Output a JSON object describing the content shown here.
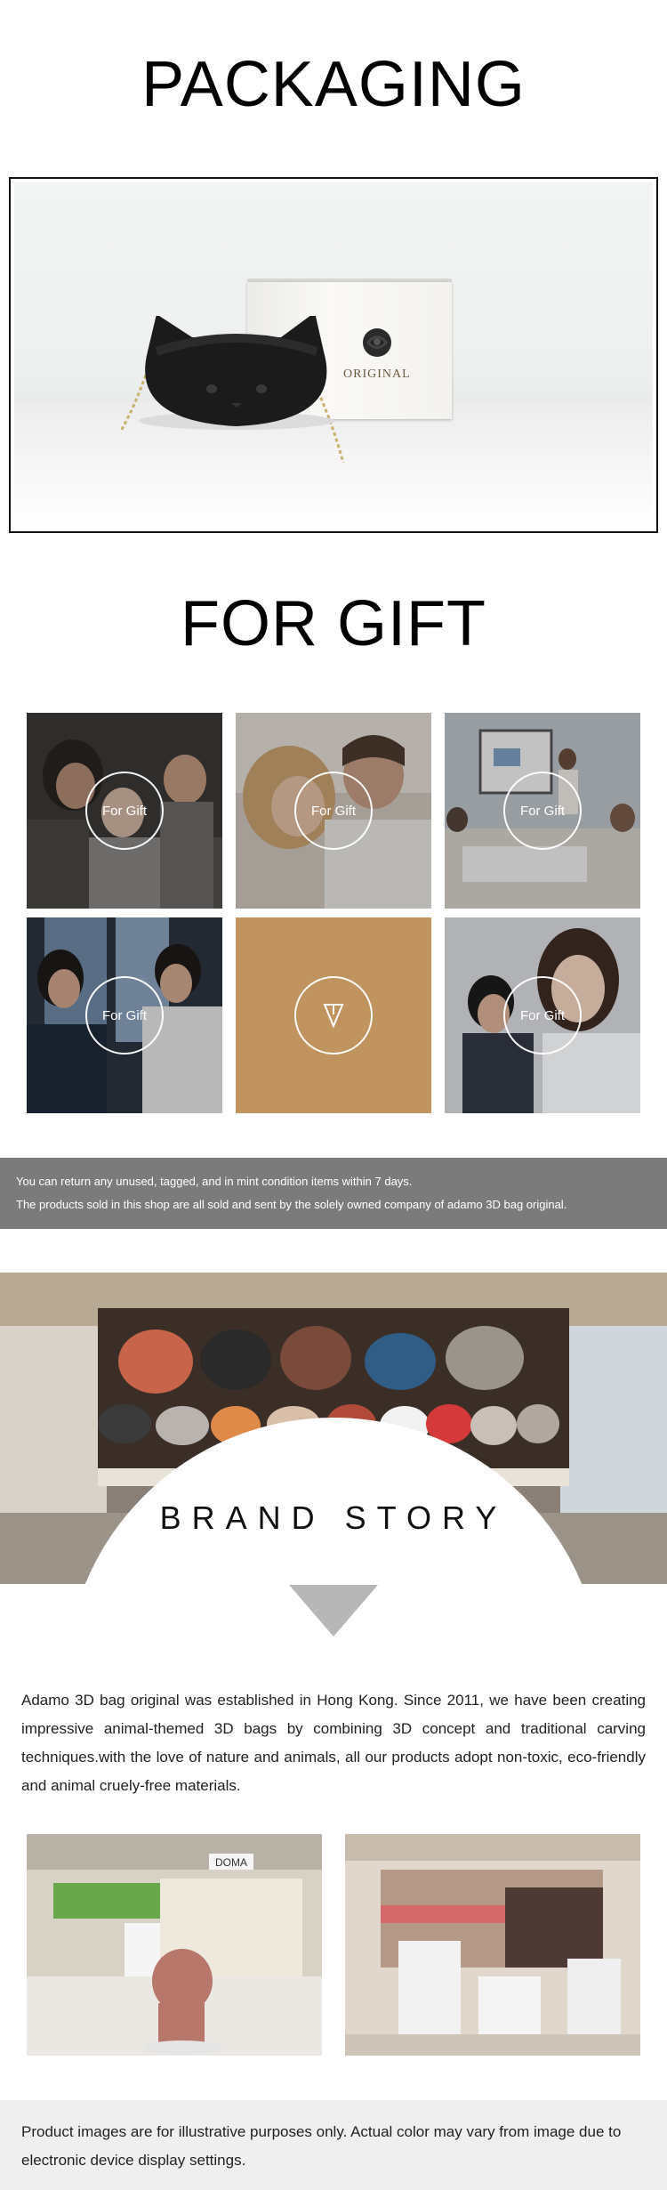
{
  "packaging": {
    "title": "PACKAGING",
    "box_logo_text": "ORIGINAL"
  },
  "gift": {
    "title": "FOR GIFT",
    "tiles": [
      {
        "label": "For Gift",
        "icon": "family-photo"
      },
      {
        "label": "For Gift",
        "icon": "couple-photo"
      },
      {
        "label": "For Gift",
        "icon": "office-meeting-photo"
      },
      {
        "label": "For Gift",
        "icon": "friends-train-photo"
      },
      {
        "label": "",
        "icon": "arrow-down-icon"
      },
      {
        "label": "For Gift",
        "icon": "colleagues-photo"
      }
    ]
  },
  "policy": {
    "line1": "You can return any unused, tagged, and in mint condition items within 7 days.",
    "line2": "The products sold in this shop are all sold and sent by the solely owned company of adamo 3D bag original."
  },
  "brand": {
    "title": "BRAND STORY",
    "story": "Adamo 3D bag original was established in Hong Kong. Since 2011, we have been creating impressive animal-themed 3D bags by combining 3D concept and traditional carving techniques.with the love of nature and animals, all our products adopt non-toxic, eco-friendly and animal cruely-free materials.",
    "store_sign": "DOMA"
  },
  "disclaimer": "Product images are for illustrative purposes only. Actual color may vary from image due to electronic device display settings.",
  "colors": {
    "tile_accent": "#c0935f",
    "info_bar": "#7b7b7b",
    "triangle": "#b7b7b7",
    "footer_bg": "#efefef"
  }
}
